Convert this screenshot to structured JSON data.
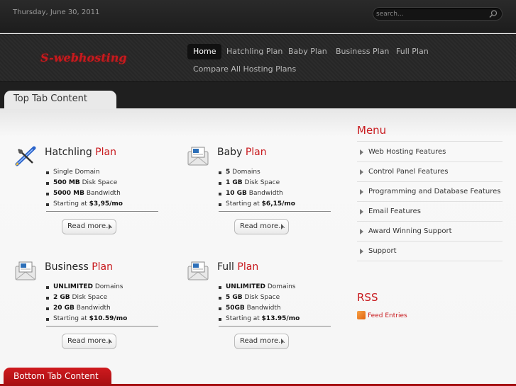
{
  "topbar": {
    "date": "Thursday, June 30, 2011",
    "search_placeholder": "search..."
  },
  "header": {
    "logo": "S-webhosting"
  },
  "nav": [
    {
      "label": "Home",
      "active": true
    },
    {
      "label": "Hatchling Plan"
    },
    {
      "label": "Baby Plan"
    },
    {
      "label": "Business Plan"
    },
    {
      "label": "Full Plan"
    },
    {
      "label": "Compare All Hosting Plans"
    }
  ],
  "tabs": {
    "top": "Top Tab Content",
    "bottom": "Bottom Tab Content"
  },
  "plans": [
    {
      "name": "Hatchling",
      "suffix": "Plan",
      "icon": "pencil-tools-icon",
      "features": [
        {
          "bold": "",
          "text": "Single Domain"
        },
        {
          "bold": "500 MB",
          "text": " Disk Space"
        },
        {
          "bold": "5000 MB",
          "text": " Bandwidth"
        },
        {
          "bold_prefix": "Starting at ",
          "bold": "$3,95",
          "text": "/mo"
        }
      ],
      "more": "Read more..."
    },
    {
      "name": "Baby",
      "suffix": "Plan",
      "icon": "mail-icon",
      "features": [
        {
          "bold": "5",
          "text": " Domains"
        },
        {
          "bold": "1 GB",
          "text": " Disk Space"
        },
        {
          "bold": "10 GB",
          "text": " Bandwidth"
        },
        {
          "bold_prefix": "Starting at ",
          "bold": "$6,15",
          "text": "/mo"
        }
      ],
      "more": "Read more..."
    },
    {
      "name": "Business",
      "suffix": "Plan",
      "icon": "mail-icon",
      "features": [
        {
          "bold": "UNLIMITED",
          "text": " Domains"
        },
        {
          "bold": "2 GB",
          "text": " Disk Space"
        },
        {
          "bold": "20 GB",
          "text": " Bandwidth"
        },
        {
          "bold_prefix": "Starting at ",
          "bold": "$10.59",
          "text": "/mo"
        }
      ],
      "more": "Read more..."
    },
    {
      "name": "Full",
      "suffix": "Plan",
      "icon": "mail-icon",
      "features": [
        {
          "bold": "UNLIMITED",
          "text": " Domains"
        },
        {
          "bold": "5 GB",
          "text": " Disk Space"
        },
        {
          "bold": "50GB",
          "text": " Bandwidth"
        },
        {
          "bold_prefix": "Starting at ",
          "bold": "$13.95",
          "text": "/mo"
        }
      ],
      "more": "Read more..."
    }
  ],
  "sidebar": {
    "menu_title": "Menu",
    "menu": [
      "Web Hosting Features",
      "Control Panel Features",
      "Programming and Database Features",
      "Email Features",
      "Award Winning Support",
      "Support"
    ],
    "rss_title": "RSS",
    "rss_link": "Feed Entries"
  },
  "colors": {
    "accent": "#c8191d",
    "dark": "#1f1f1f"
  }
}
